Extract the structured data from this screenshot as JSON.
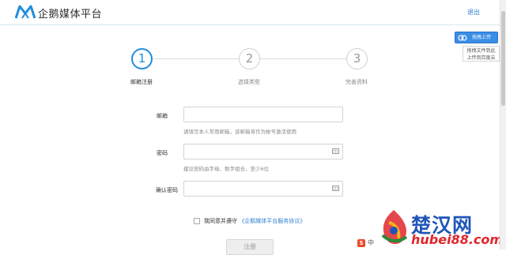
{
  "header": {
    "brand": "企鹅媒体平台",
    "logout_label": "退出"
  },
  "upload": {
    "button_label": "拖拽上传",
    "tooltip_line1": "拖拽文件到此",
    "tooltip_line2": "上传到百度云"
  },
  "steps": [
    {
      "number": "1",
      "label": "邮箱注册",
      "active": true
    },
    {
      "number": "2",
      "label": "选择类型",
      "active": false
    },
    {
      "number": "3",
      "label": "完善资料",
      "active": false
    }
  ],
  "form": {
    "email_label": "邮箱",
    "email_value": "",
    "email_hint": "请填写本人常用邮箱，该邮箱将作为帐号激活使用",
    "password_label": "密码",
    "password_value": "",
    "password_hint": "建议密码由字母、数字组合，至少6位",
    "confirm_label": "确认密码",
    "confirm_value": "",
    "agree_prefix": "我同意并遵守",
    "agree_link": "《企鹅媒体平台服务协议》",
    "agree_checked": false,
    "next_label": "注册"
  },
  "ime": {
    "logo_letter": "S",
    "mode": "中"
  },
  "watermark": {
    "title": "楚汉网",
    "url": "hubei88.com"
  },
  "colors": {
    "accent": "#1e8ddd",
    "link": "#2f7fd0",
    "watermark_blue": "#1f55b8",
    "watermark_red": "#e0262b"
  }
}
